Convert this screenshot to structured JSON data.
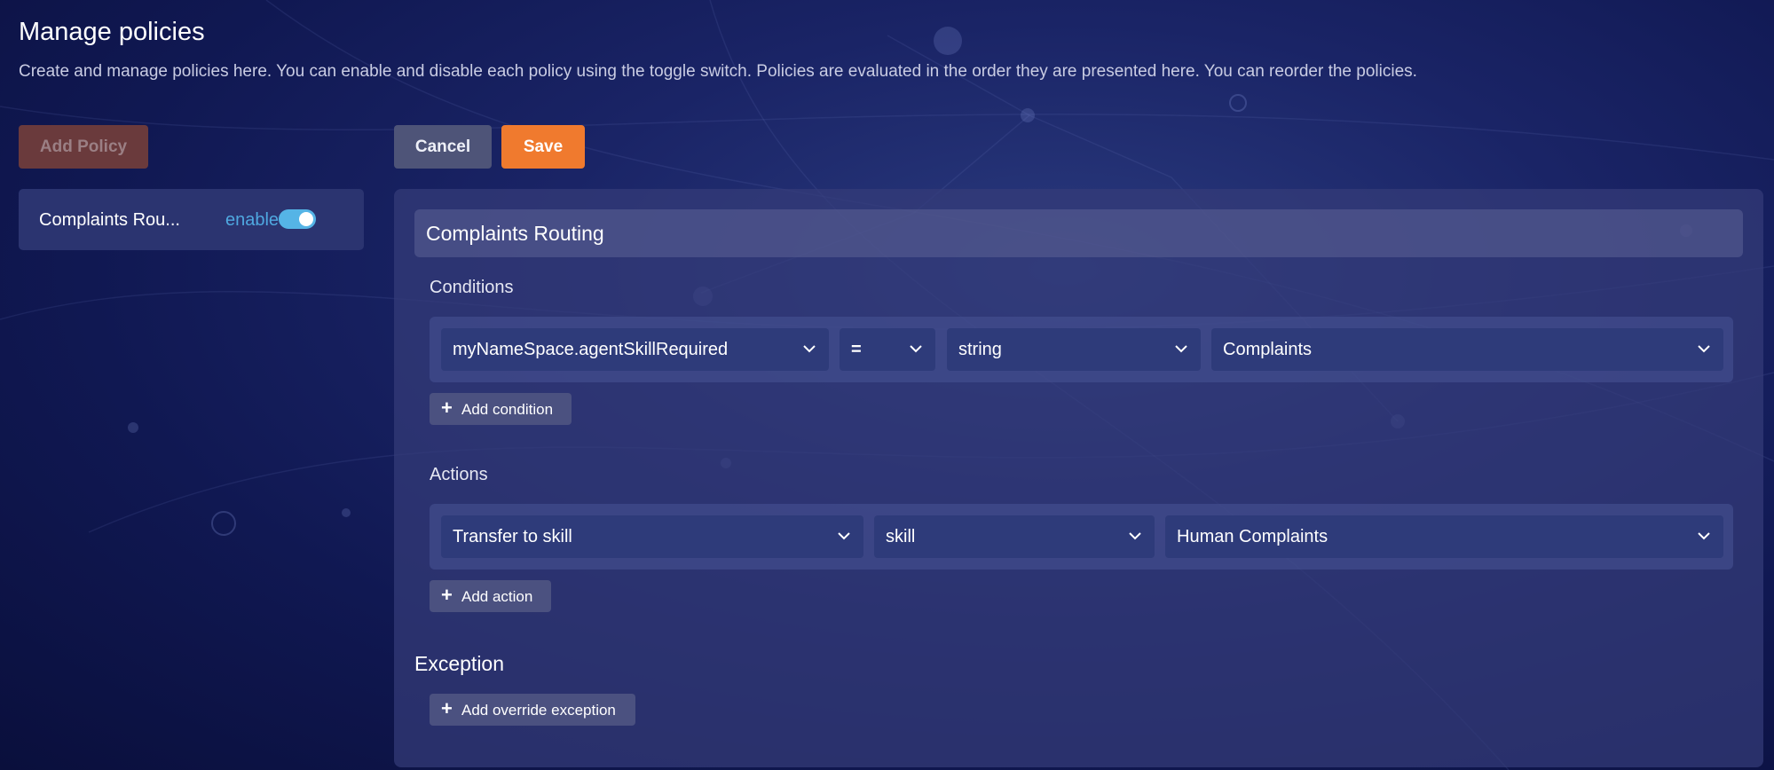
{
  "page": {
    "title": "Manage policies",
    "subtitle": "Create and manage policies here. You can enable and disable each policy using the toggle switch. Policies are evaluated in the order they are presented here. You can reorder the policies."
  },
  "toolbar": {
    "add_policy_label": "Add Policy",
    "cancel_label": "Cancel",
    "save_label": "Save"
  },
  "policy_list": {
    "items": [
      {
        "name": "Complaints Rou...",
        "status": "enabled",
        "enabled": true
      }
    ]
  },
  "editor": {
    "policy_name": "Complaints Routing",
    "conditions_label": "Conditions",
    "condition": {
      "field": "myNameSpace.agentSkillRequired",
      "operator": "=",
      "type": "string",
      "value": "Complaints"
    },
    "add_condition_label": "Add condition",
    "actions_label": "Actions",
    "action": {
      "type": "Transfer to skill",
      "target": "skill",
      "value": "Human Complaints"
    },
    "add_action_label": "Add action",
    "exception_label": "Exception",
    "add_exception_label": "Add override exception"
  },
  "icons": {
    "dropdown": "chevron-down-icon",
    "add": "plus-icon"
  },
  "colors": {
    "accent_orange": "#f07a2e",
    "toggle_blue": "#55b4e6",
    "status_text": "#4fa8e0"
  }
}
